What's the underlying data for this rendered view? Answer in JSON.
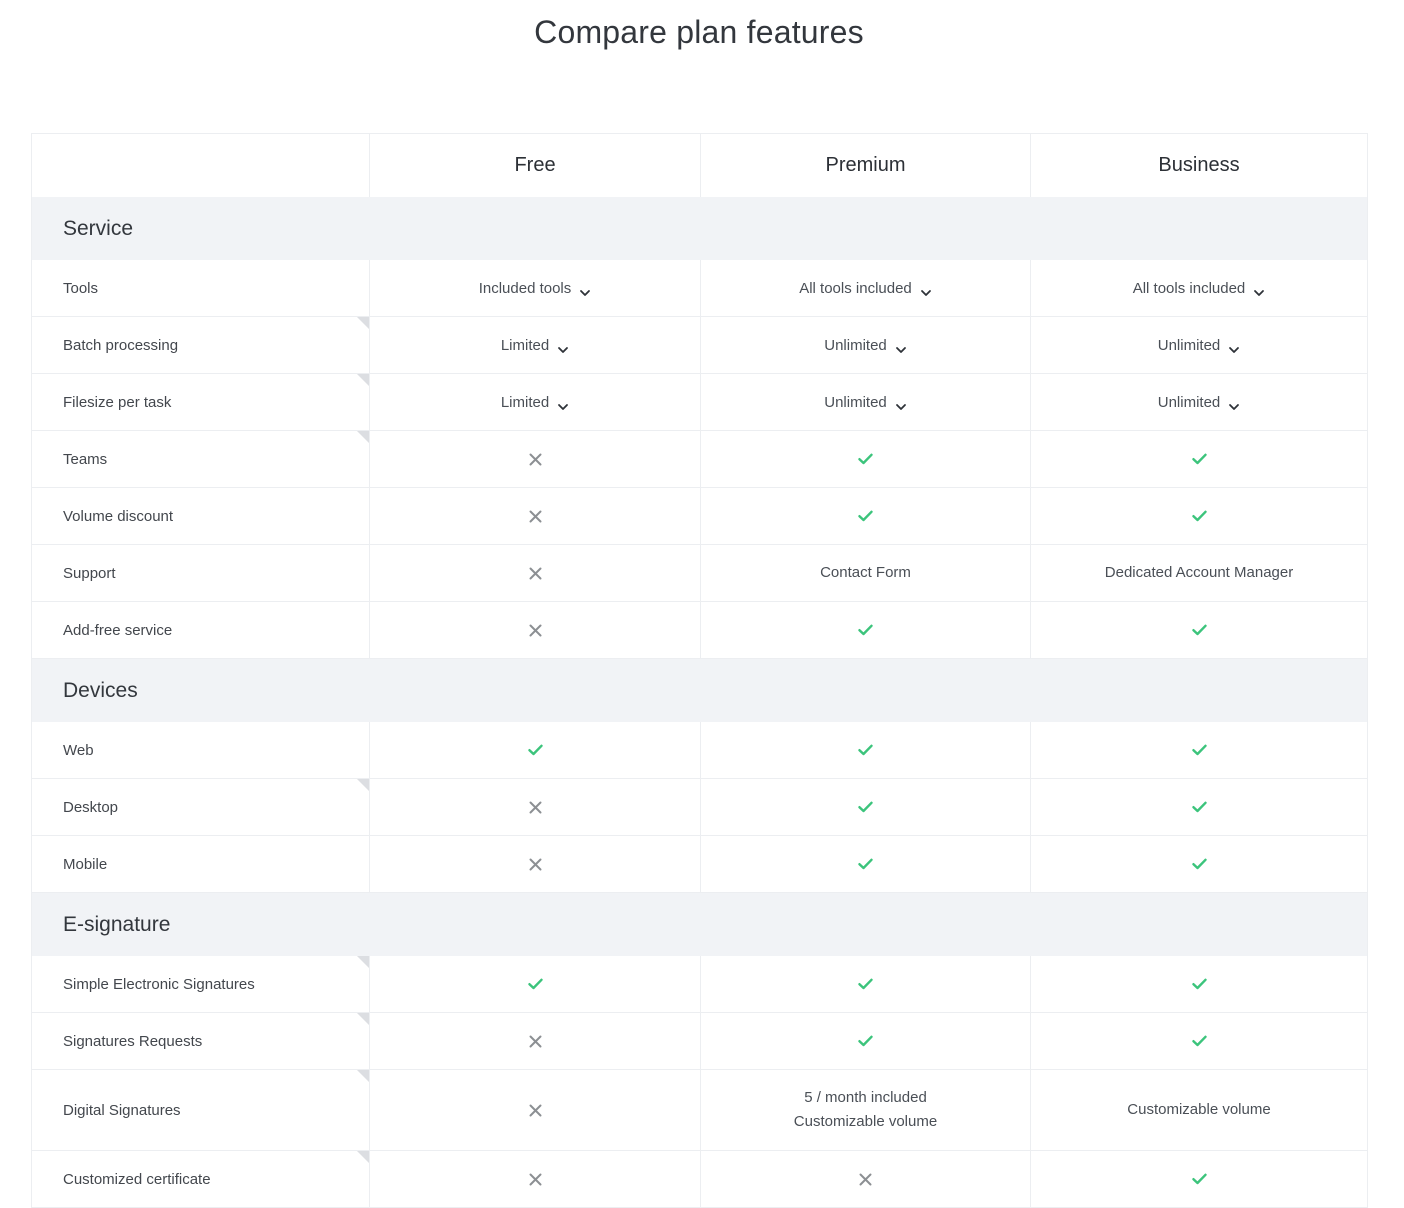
{
  "title": "Compare plan features",
  "plans": [
    "Free",
    "Premium",
    "Business"
  ],
  "colors": {
    "check": "#3cc47c",
    "cross": "#8c8f93",
    "section_bg": "#f1f3f6",
    "border": "#eceef1",
    "tooltip_corner": "#dcdee2"
  },
  "sections": [
    {
      "label": "Service",
      "rows": [
        {
          "label": "Tools",
          "has_tooltip": false,
          "values": [
            {
              "type": "dropdown",
              "text": "Included tools"
            },
            {
              "type": "dropdown",
              "text": "All tools included"
            },
            {
              "type": "dropdown",
              "text": "All tools included"
            }
          ]
        },
        {
          "label": "Batch processing",
          "has_tooltip": true,
          "values": [
            {
              "type": "dropdown",
              "text": "Limited"
            },
            {
              "type": "dropdown",
              "text": "Unlimited"
            },
            {
              "type": "dropdown",
              "text": "Unlimited"
            }
          ]
        },
        {
          "label": "Filesize per task",
          "has_tooltip": true,
          "values": [
            {
              "type": "dropdown",
              "text": "Limited"
            },
            {
              "type": "dropdown",
              "text": "Unlimited"
            },
            {
              "type": "dropdown",
              "text": "Unlimited"
            }
          ]
        },
        {
          "label": "Teams",
          "has_tooltip": true,
          "values": [
            {
              "type": "cross"
            },
            {
              "type": "check"
            },
            {
              "type": "check"
            }
          ]
        },
        {
          "label": "Volume discount",
          "has_tooltip": false,
          "values": [
            {
              "type": "cross"
            },
            {
              "type": "check"
            },
            {
              "type": "check"
            }
          ]
        },
        {
          "label": "Support",
          "has_tooltip": false,
          "values": [
            {
              "type": "cross"
            },
            {
              "type": "text",
              "text": "Contact Form"
            },
            {
              "type": "text",
              "text": "Dedicated Account Manager"
            }
          ]
        },
        {
          "label": "Add-free service",
          "has_tooltip": false,
          "values": [
            {
              "type": "cross"
            },
            {
              "type": "check"
            },
            {
              "type": "check"
            }
          ]
        }
      ]
    },
    {
      "label": "Devices",
      "rows": [
        {
          "label": "Web",
          "has_tooltip": false,
          "values": [
            {
              "type": "check"
            },
            {
              "type": "check"
            },
            {
              "type": "check"
            }
          ]
        },
        {
          "label": "Desktop",
          "has_tooltip": true,
          "values": [
            {
              "type": "cross"
            },
            {
              "type": "check"
            },
            {
              "type": "check"
            }
          ]
        },
        {
          "label": "Mobile",
          "has_tooltip": false,
          "values": [
            {
              "type": "cross"
            },
            {
              "type": "check"
            },
            {
              "type": "check"
            }
          ]
        }
      ]
    },
    {
      "label": "E-signature",
      "rows": [
        {
          "label": "Simple Electronic Signatures",
          "has_tooltip": true,
          "values": [
            {
              "type": "check"
            },
            {
              "type": "check"
            },
            {
              "type": "check"
            }
          ]
        },
        {
          "label": "Signatures Requests",
          "has_tooltip": true,
          "values": [
            {
              "type": "cross"
            },
            {
              "type": "check"
            },
            {
              "type": "check"
            }
          ]
        },
        {
          "label": "Digital Signatures",
          "has_tooltip": true,
          "tall": true,
          "values": [
            {
              "type": "cross"
            },
            {
              "type": "multi",
              "lines": [
                "5 / month included",
                "Customizable volume"
              ]
            },
            {
              "type": "text",
              "text": "Customizable volume"
            }
          ]
        },
        {
          "label": "Customized certificate",
          "has_tooltip": true,
          "values": [
            {
              "type": "cross"
            },
            {
              "type": "cross"
            },
            {
              "type": "check"
            }
          ]
        }
      ]
    }
  ]
}
